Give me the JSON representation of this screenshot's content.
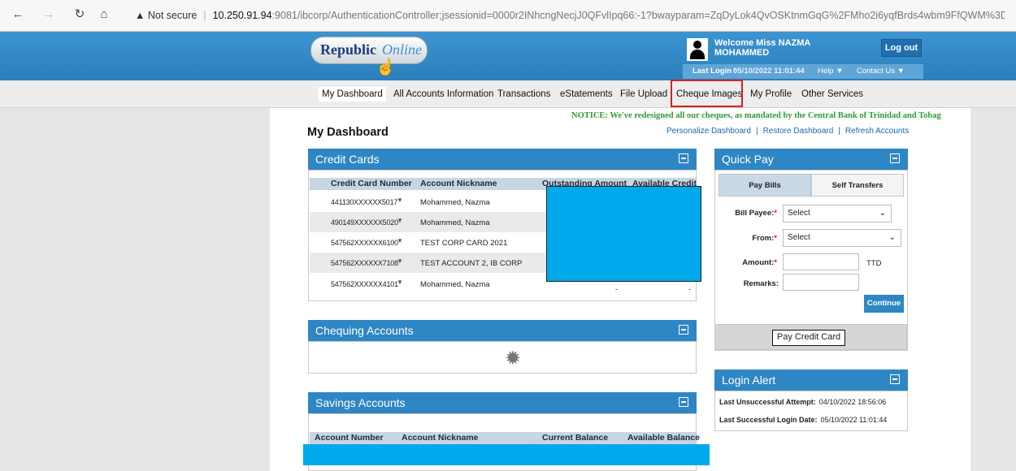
{
  "browser": {
    "not_secure": "Not secure",
    "host": "10.250.91.94",
    "path": ":9081/ibcorp/AuthenticationController;jsessionid=0000r2INhcngNecjJ0QFvlIpq66:-1?bwayparam=ZqDyLok4QvOSKtnmGqG%2FMho2i6yqfBrds4wbm9FfQWM%3D"
  },
  "header": {
    "logo_republic": "Republic",
    "logo_online": "Online",
    "welcome_line1": "Welcome  Miss  NAZMA",
    "welcome_line2": "MOHAMMED",
    "logout": "Log out",
    "last_login_label": "Last Login :",
    "last_login_value": "05/10/2022 11:01:44",
    "help": "Help",
    "contact": "Contact Us"
  },
  "nav": {
    "items": [
      "My Dashboard",
      "All Accounts Information",
      "Transactions",
      "eStatements",
      "File Upload",
      "Cheque Images",
      "My Profile",
      "Other Services"
    ]
  },
  "notice": "NOTICE: We've redesigned all our cheques, as mandated by the Central Bank of Trinidad and Tobag",
  "page": {
    "title": "My Dashboard",
    "links": [
      "Personalize Dashboard",
      "Restore Dashboard",
      "Refresh Accounts"
    ]
  },
  "credit_cards": {
    "title": "Credit Cards",
    "columns": [
      "Credit Card Number",
      "Account Nickname",
      "Outstanding Amount",
      "Available Credit"
    ],
    "rows": [
      {
        "number": "441130XXXXXX5017",
        "nickname": "Mohammed, Nazma"
      },
      {
        "number": "490149XXXXXX5020",
        "nickname": "Mohammed, Nazma"
      },
      {
        "number": "547562XXXXXX6100",
        "nickname": "TEST CORP CARD 2021"
      },
      {
        "number": "547562XXXXXX7108",
        "nickname": "TEST ACCOUNT 2, IB CORP"
      },
      {
        "number": "547562XXXXXX4101",
        "nickname": "Mohammed, Nazma"
      }
    ],
    "trailing_marks": [
      "-",
      "-"
    ]
  },
  "chequing": {
    "title": "Chequing Accounts"
  },
  "savings": {
    "title": "Savings Accounts",
    "columns": [
      "Account Number",
      "Account Nickname",
      "Current Balance",
      "Available Balance"
    ]
  },
  "quick_pay": {
    "title": "Quick Pay",
    "tab_pay_bills": "Pay Bills",
    "tab_self_transfers": "Self Transfers",
    "bill_payee_label": "Bill Payee:",
    "from_label": "From:",
    "amount_label": "Amount:",
    "remarks_label": "Remarks:",
    "required_mark": "*",
    "select_placeholder": "Select",
    "currency": "TTD",
    "continue": "Continue",
    "pay_credit_card": "Pay Credit Card"
  },
  "login_alert": {
    "title": "Login Alert",
    "unsuccessful_label": "Last Unsuccessful Attempt:",
    "unsuccessful_value": "04/10/2022 18:56:06",
    "successful_label": "Last Successful Login Date:",
    "successful_value": "05/10/2022 11:01:44"
  },
  "colors": {
    "header_blue": "#2f86c4",
    "redaction": "#00a8ec",
    "notice_green": "#2f9a36",
    "highlight_red": "#d62020"
  }
}
